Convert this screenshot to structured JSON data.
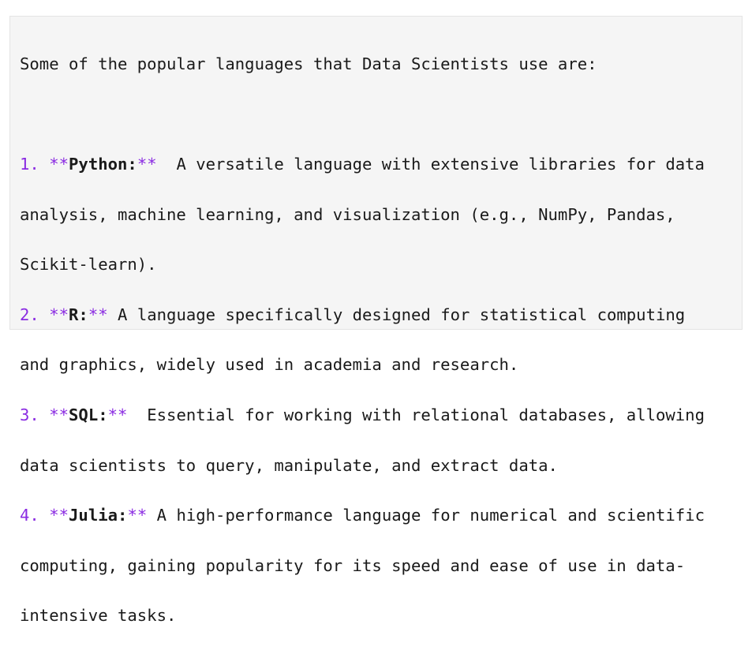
{
  "intro": "Some of the popular languages that Data Scientists use are:",
  "items": [
    {
      "marker": "1.",
      "name_prefix": "**",
      "name": "Python:",
      "name_suffix": "**",
      "lines": [
        "  A versatile language with extensive libraries for data",
        "analysis, machine learning, and visualization (e.g., NumPy, Pandas,",
        "Scikit-learn)."
      ]
    },
    {
      "marker": "2.",
      "name_prefix": "**",
      "name": "R:",
      "name_suffix": "**",
      "lines": [
        " A language specifically designed for statistical computing",
        "and graphics, widely used in academia and research."
      ]
    },
    {
      "marker": "3.",
      "name_prefix": "**",
      "name": "SQL:",
      "name_suffix": "**",
      "lines": [
        "  Essential for working with relational databases, allowing",
        "data scientists to query, manipulate, and extract data."
      ]
    },
    {
      "marker": "4.",
      "name_prefix": "**",
      "name": "Julia:",
      "name_suffix": "**",
      "lines": [
        " A high-performance language for numerical and scientific",
        "computing, gaining popularity for its speed and ease of use in data-",
        "intensive tasks."
      ]
    }
  ],
  "colors": {
    "markdown_syntax": "#8a2be2",
    "panel_background": "#f5f5f5",
    "text": "#1a1a1a"
  }
}
